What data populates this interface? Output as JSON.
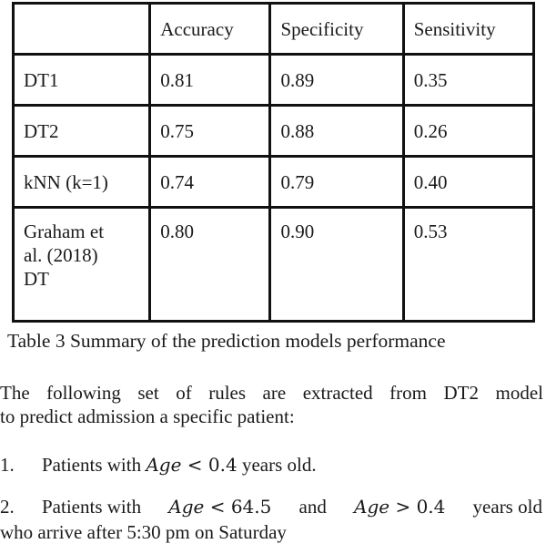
{
  "table": {
    "headers": [
      "",
      "Accuracy",
      "Specificity",
      "Sensitivity"
    ],
    "rows": [
      {
        "model": "DT1",
        "accuracy": "0.81",
        "specificity": "0.89",
        "sensitivity": "0.35"
      },
      {
        "model": "DT2",
        "accuracy": "0.75",
        "specificity": "0.88",
        "sensitivity": "0.26"
      },
      {
        "model": "kNN (k=1)",
        "accuracy": "0.74",
        "specificity": "0.79",
        "sensitivity": "0.40"
      },
      {
        "model_lines": [
          "Graham et",
          "al. (2018)",
          "DT"
        ],
        "accuracy": "0.80",
        "specificity": "0.90",
        "sensitivity": "0.53"
      }
    ]
  },
  "caption": "Table 3 Summary of the prediction models performance",
  "paragraph": {
    "line1": "The following set of rules are extracted from DT2 model",
    "line2": "to predict admission a specific patient:"
  },
  "rules": [
    {
      "number": "1.",
      "prefix": "Patients with",
      "math": {
        "var": "Age",
        "op": "<",
        "value": "0.4"
      },
      "suffix": "years old."
    },
    {
      "number": "2.",
      "prefix": "Patients with",
      "math1": {
        "var": "Age",
        "op": "<",
        "value": "64.5"
      },
      "conj": "and",
      "math2": {
        "var": "Age",
        "op": ">",
        "value": "0.4"
      },
      "suffix": "years old"
    }
  ],
  "continuation": "who arrive after 5:30 pm on Saturday"
}
